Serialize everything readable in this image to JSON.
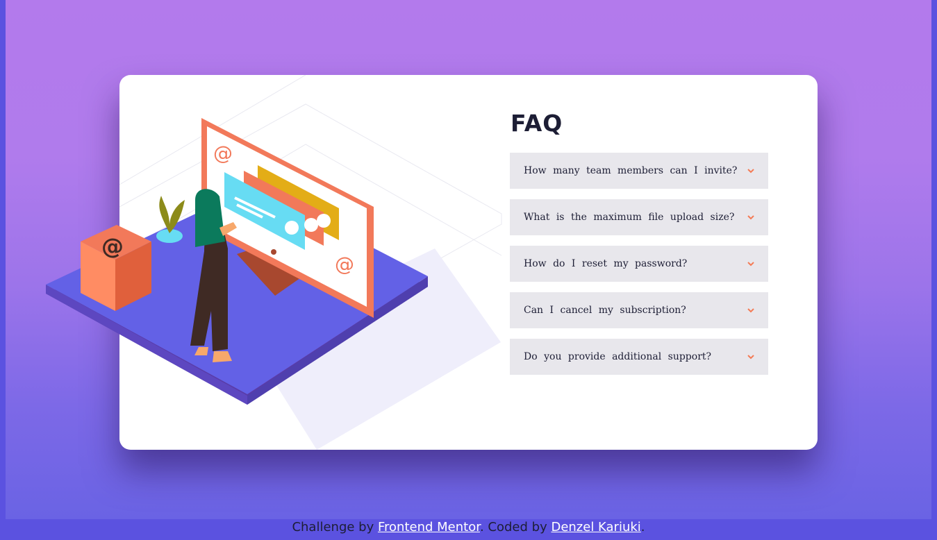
{
  "faq": {
    "title": "FAQ",
    "items": [
      {
        "question": "How many team members can I invite?"
      },
      {
        "question": "What is the maximum file upload size?"
      },
      {
        "question": "How do I reset my password?"
      },
      {
        "question": "Can I cancel my subscription?"
      },
      {
        "question": "Do you provide additional support?"
      }
    ]
  },
  "footer": {
    "prefix": "Challenge by ",
    "link1": "Frontend Mentor",
    "middle": ". Coded by ",
    "link2": "Denzel Kariuki",
    "suffix": "."
  },
  "colors": {
    "accent": "#f47b56",
    "title": "#1d1e35",
    "item_bg": "#e8e7ec",
    "platform": "#6361e6",
    "bg_top": "#b37aec",
    "bg_bottom": "#5b52e0"
  }
}
